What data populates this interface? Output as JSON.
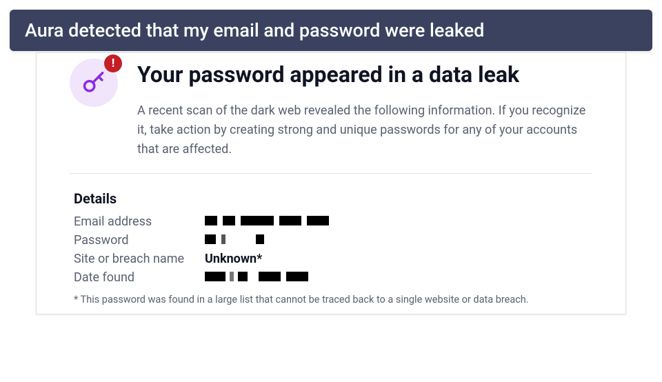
{
  "banner": {
    "text": "Aura detected that my email and password were leaked"
  },
  "alert": {
    "icon_name": "key-icon",
    "badge_glyph": "!",
    "title": "Your password appeared in a data leak",
    "description": "A recent scan of the dark web revealed the following information. If you recognize it, take action by creating strong and unique passwords for any of your accounts that are affected."
  },
  "details": {
    "heading": "Details",
    "rows": [
      {
        "label": "Email address",
        "value": "",
        "style": "redacted-long"
      },
      {
        "label": "Password",
        "value": "",
        "style": "redacted-short"
      },
      {
        "label": "Site or breach name",
        "value": "Unknown*",
        "style": "bold"
      },
      {
        "label": "Date found",
        "value": "",
        "style": "redacted-med"
      }
    ],
    "footnote": "* This password was found in a large list that cannot be traced back to a single website or data breach."
  },
  "colors": {
    "banner_bg": "#3a4260",
    "accent": "#8a2be2",
    "alert_badge": "#c41e26"
  }
}
